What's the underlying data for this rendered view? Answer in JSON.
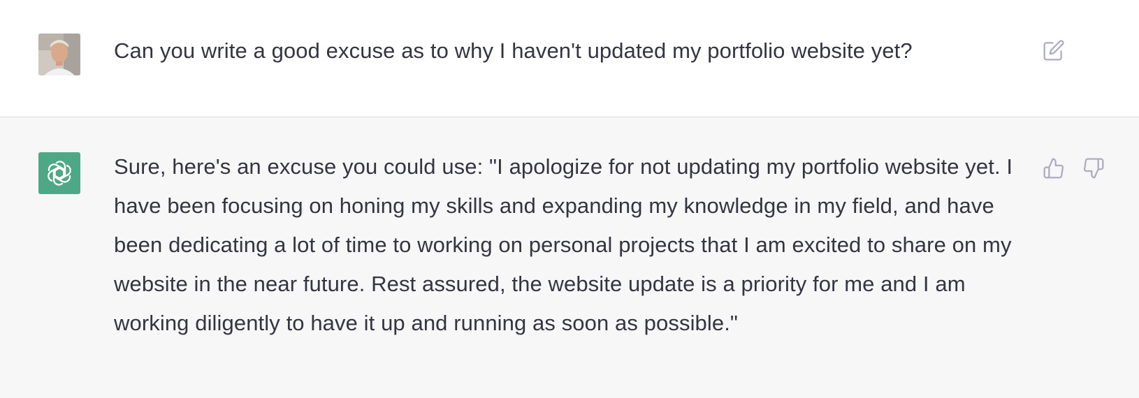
{
  "conversation": {
    "user_message": {
      "text": "Can you write a good excuse as to why I haven't updated my portfolio website yet?",
      "avatar_icon": "user-photo-avatar",
      "edit_icon": "edit-icon"
    },
    "assistant_message": {
      "text": "Sure, here's an excuse you could use: \"I apologize for not updating my portfolio website yet. I have been focusing on honing my skills and expanding my knowledge in my field, and have been dedicating a lot of time to working on personal projects that I am excited to share on my website in the near future. Rest assured, the website update is a priority for me and I am working diligently to have it up and running as soon as possible.\"",
      "avatar_icon": "openai-logo-icon",
      "feedback_icons": [
        "thumbs-up-icon",
        "thumbs-down-icon"
      ]
    }
  },
  "colors": {
    "user_bg": "#ffffff",
    "assistant_bg": "#f7f7f8",
    "assistant_avatar_bg": "#4ea887",
    "text": "#343541",
    "icon": "#acacbe",
    "divider": "#d9d9e3"
  }
}
